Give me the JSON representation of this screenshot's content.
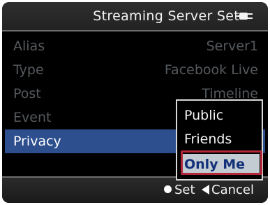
{
  "header": {
    "title": "Streaming Server Set",
    "icon": "plug-icon"
  },
  "settings": [
    {
      "label": "Alias",
      "value": "Server1"
    },
    {
      "label": "Type",
      "value": "Facebook Live"
    },
    {
      "label": "Post",
      "value": "Timeline"
    },
    {
      "label": "Event",
      "value": ""
    },
    {
      "label": "Privacy",
      "value": ""
    }
  ],
  "privacy_dropdown": {
    "options": [
      "Public",
      "Friends",
      "Only Me"
    ],
    "selected": "Only Me"
  },
  "footer": {
    "set_label": "Set",
    "cancel_label": "Cancel"
  },
  "colors": {
    "selection_blue": "#2d4f8e",
    "highlight_box_red": "#b0283a",
    "selected_option_bg": "#c3ccd3"
  }
}
